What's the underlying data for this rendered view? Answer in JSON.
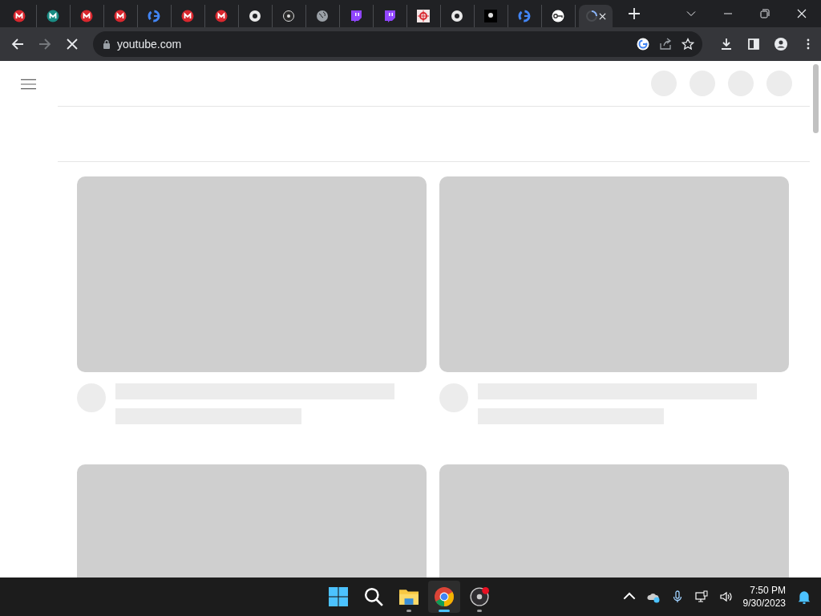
{
  "tabs": [
    {
      "kind": "mega",
      "selected": false
    },
    {
      "kind": "teal",
      "selected": false
    },
    {
      "kind": "mega",
      "selected": false
    },
    {
      "kind": "mega",
      "selected": false
    },
    {
      "kind": "google",
      "selected": false
    },
    {
      "kind": "mega",
      "selected": false
    },
    {
      "kind": "mega",
      "selected": false
    },
    {
      "kind": "chrome",
      "selected": false
    },
    {
      "kind": "obs",
      "selected": false
    },
    {
      "kind": "globe",
      "selected": false
    },
    {
      "kind": "twitch",
      "selected": false
    },
    {
      "kind": "twitch",
      "selected": false
    },
    {
      "kind": "target",
      "selected": false
    },
    {
      "kind": "chrome",
      "selected": false
    },
    {
      "kind": "dark",
      "selected": false
    },
    {
      "kind": "google",
      "selected": false
    },
    {
      "kind": "key",
      "selected": false
    },
    {
      "kind": "loading",
      "selected": true
    }
  ],
  "address_bar": {
    "url": "youtube.com",
    "loading": true
  },
  "page": {
    "header_placeholders": [
      {
        "kind": "circle"
      },
      {
        "kind": "circle"
      },
      {
        "kind": "circle"
      },
      {
        "kind": "circle"
      }
    ],
    "video_placeholders": [
      {
        "kind": "skeleton"
      },
      {
        "kind": "skeleton"
      },
      {
        "kind": "thumbnail"
      },
      {
        "kind": "thumbnail"
      }
    ]
  },
  "taskbar": {
    "apps": [
      {
        "kind": "start",
        "running": false,
        "active": false
      },
      {
        "kind": "search",
        "running": false,
        "active": false
      },
      {
        "kind": "files",
        "running": true,
        "active": false
      },
      {
        "kind": "chrome",
        "running": true,
        "active": true
      },
      {
        "kind": "obs",
        "running": true,
        "active": false
      }
    ],
    "clock": {
      "time": "7:50 PM",
      "date": "9/30/2023"
    }
  }
}
